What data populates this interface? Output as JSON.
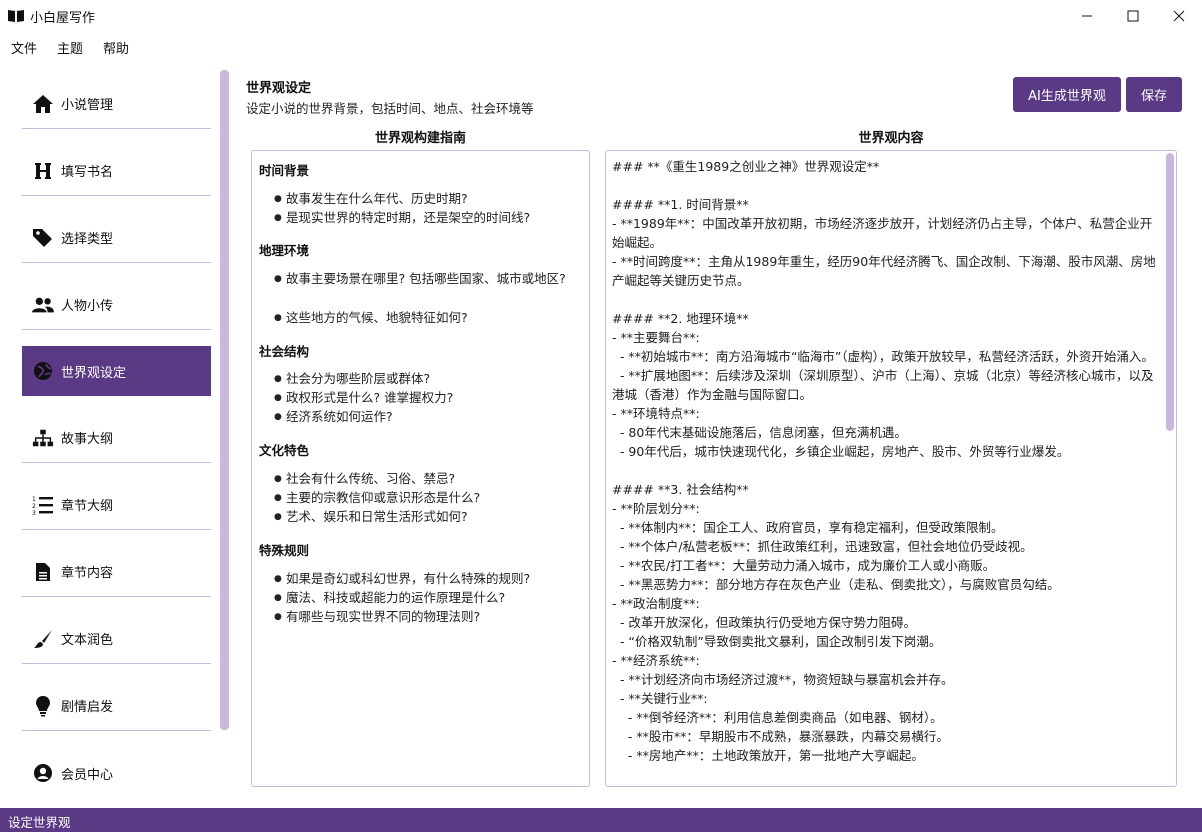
{
  "window": {
    "title": "小白屋写作"
  },
  "menu": [
    "文件",
    "主题",
    "帮助"
  ],
  "sidebar": {
    "items": [
      {
        "label": "小说管理",
        "icon": "home-icon"
      },
      {
        "label": "填写书名",
        "icon": "heading-icon"
      },
      {
        "label": "选择类型",
        "icon": "tags-icon"
      },
      {
        "label": "人物小传",
        "icon": "users-icon"
      },
      {
        "label": "世界观设定",
        "icon": "globe-icon",
        "active": true
      },
      {
        "label": "故事大纲",
        "icon": "sitemap-icon"
      },
      {
        "label": "章节大纲",
        "icon": "list-ol-icon"
      },
      {
        "label": "章节内容",
        "icon": "file-text-icon"
      },
      {
        "label": "文本润色",
        "icon": "brush-icon"
      },
      {
        "label": "剧情启发",
        "icon": "lightbulb-icon"
      },
      {
        "label": "会员中心",
        "icon": "user-circle-icon"
      }
    ]
  },
  "main": {
    "title": "世界观设定",
    "subtitle": "设定小说的世界背景，包括时间、地点、社会环境等",
    "ai_button": "AI生成世界观",
    "save_button": "保存",
    "guide_header": "世界观构建指南",
    "content_header": "世界观内容"
  },
  "guide": {
    "sections": [
      {
        "title": "时间背景",
        "items": [
          "故事发生在什么年代、历史时期?",
          "是现实世界的特定时期，还是架空的时间线?"
        ]
      },
      {
        "title": "地理环境",
        "items": [
          "故事主要场景在哪里? 包括哪些国家、城市或地区?",
          "这些地方的气候、地貌特征如何?"
        ]
      },
      {
        "title": "社会结构",
        "items": [
          "社会分为哪些阶层或群体?",
          "政权形式是什么? 谁掌握权力?",
          "经济系统如何运作?"
        ]
      },
      {
        "title": "文化特色",
        "items": [
          "社会有什么传统、习俗、禁忌?",
          "主要的宗教信仰或意识形态是什么?",
          "艺术、娱乐和日常生活形式如何?"
        ]
      },
      {
        "title": "特殊规则",
        "items": [
          "如果是奇幻或科幻世界，有什么特殊的规则?",
          "魔法、科技或超能力的运作原理是什么?",
          "有哪些与现实世界不同的物理法则?"
        ]
      }
    ]
  },
  "content": {
    "lines": [
      "### **《重生1989之创业之神》世界观设定**",
      "",
      "#### **1. 时间背景**",
      "- **1989年**：中国改革开放初期，市场经济逐步放开，计划经济仍占主导，个体户、私营企业开始崛起。",
      "- **时间跨度**：主角从1989年重生，经历90年代经济腾飞、国企改制、下海潮、股市风潮、房地产崛起等关键历史节点。",
      "",
      "#### **2. 地理环境**",
      "- **主要舞台**:",
      "  - **初始城市**：南方沿海城市“临海市”（虚构），政策开放较早，私营经济活跃，外资开始涌入。",
      "  - **扩展地图**：后续涉及深圳（深圳原型）、沪市（上海）、京城（北京）等经济核心城市，以及港城（香港）作为金融与国际窗口。",
      "- **环境特点**:",
      "  - 80年代末基础设施落后，信息闭塞，但充满机遇。",
      "  - 90年代后，城市快速现代化，乡镇企业崛起，房地产、股市、外贸等行业爆发。",
      "",
      "#### **3. 社会结构**",
      "- **阶层划分**:",
      "  - **体制内**：国企工人、政府官员，享有稳定福利，但受政策限制。",
      "  - **个体户/私营老板**：抓住政策红利，迅速致富，但社会地位仍受歧视。",
      "  - **农民/打工者**：大量劳动力涌入城市，成为廉价工人或小商贩。",
      "  - **黑恶势力**：部分地方存在灰色产业（走私、倒卖批文），与腐败官员勾结。",
      "- **政治制度**:",
      "  - 改革开放深化，但政策执行仍受地方保守势力阻碍。",
      "  - “价格双轨制”导致倒卖批文暴利，国企改制引发下岗潮。",
      "- **经济系统**:",
      "  - **计划经济向市场经济过渡**，物资短缺与暴富机会并存。",
      "  - **关键行业**:",
      "    - **倒爷经济**：利用信息差倒卖商品（如电器、钢材）。",
      "    - **股市**：早期股市不成熟，暴涨暴跌，内幕交易横行。",
      "    - **房地产**：土地政策放开，第一批地产大亨崛起。"
    ]
  },
  "statusbar": {
    "text": "设定世界观"
  },
  "colors": {
    "accent": "#5b3a85",
    "divider": "#c9b8dc"
  }
}
